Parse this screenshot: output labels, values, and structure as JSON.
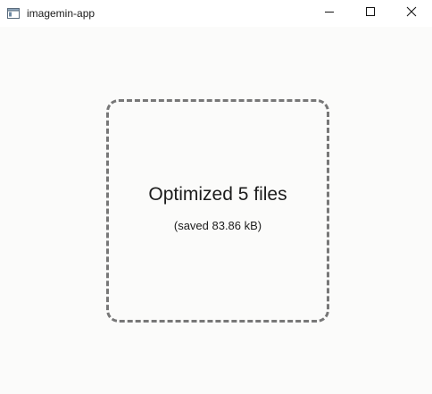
{
  "window": {
    "title": "imagemin-app"
  },
  "icons": {
    "app": "app-window-icon",
    "minimize": "minimize-icon",
    "maximize": "maximize-icon",
    "close": "close-icon"
  },
  "dropzone": {
    "status": "Optimized 5 files",
    "saved": "(saved 83.86 kB)"
  },
  "colors": {
    "background": "#fbfbfa",
    "dashed_border": "#777777",
    "text": "#1c1c1c"
  }
}
